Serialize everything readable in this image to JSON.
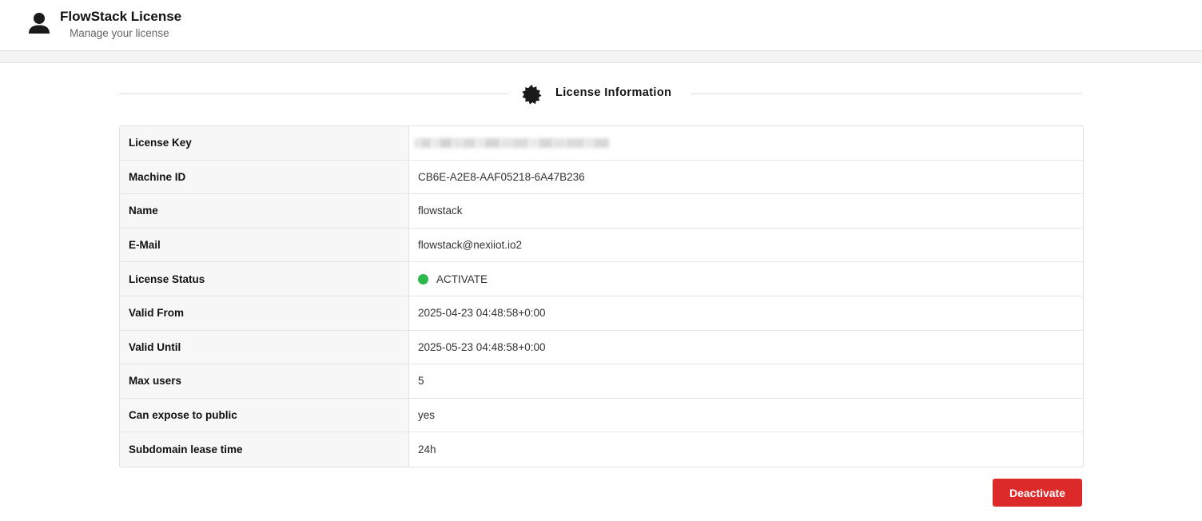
{
  "header": {
    "title": "FlowStack License",
    "subtitle": "Manage your license",
    "icon": "user-icon"
  },
  "section": {
    "title": "License Information",
    "icon": "badge-icon"
  },
  "license_rows": [
    {
      "label": "License Key",
      "value": "",
      "redacted": true
    },
    {
      "label": "Machine ID",
      "value": "CB6E-A2E8-AAF05218-6A47B236"
    },
    {
      "label": "Name",
      "value": "flowstack"
    },
    {
      "label": "E-Mail",
      "value": "flowstack@nexiiot.io2"
    },
    {
      "label": "License Status",
      "value": "ACTIVATE",
      "status_color": "#2db84c"
    },
    {
      "label": "Valid From",
      "value": "2025-04-23 04:48:58+0:00"
    },
    {
      "label": "Valid Until",
      "value": "2025-05-23 04:48:58+0:00"
    },
    {
      "label": "Max users",
      "value": "5"
    },
    {
      "label": "Can expose to public",
      "value": "yes"
    },
    {
      "label": "Subdomain lease time",
      "value": "24h"
    }
  ],
  "actions": {
    "deactivate_label": "Deactivate",
    "deactivate_color": "#dc2a2a"
  }
}
